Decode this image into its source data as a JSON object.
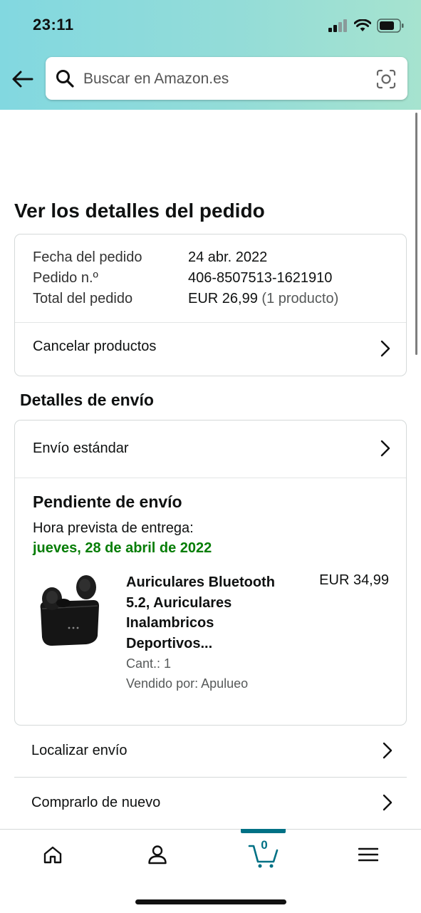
{
  "status_bar": {
    "time": "23:11"
  },
  "search": {
    "placeholder": "Buscar en Amazon.es"
  },
  "page": {
    "title": "Ver los detalles del pedido"
  },
  "order_summary": {
    "date_label": "Fecha del pedido",
    "date_value": "24 abr. 2022",
    "number_label": "Pedido n.º",
    "number_value": "406-8507513-1621910",
    "total_label": "Total del pedido",
    "total_value": "EUR 26,99",
    "total_items": "(1 producto)",
    "cancel_label": "Cancelar productos"
  },
  "shipping": {
    "section_title": "Detalles de envío",
    "method": "Envío estándar",
    "status": "Pendiente de envío",
    "eta_label": "Hora prevista de entrega:",
    "eta_date": "jueves, 28 de abril de 2022"
  },
  "product": {
    "title_line1": "Auriculares Bluetooth",
    "title_line2": "5.2, Auriculares",
    "title_line3": "Inalambricos",
    "title_line4": "Deportivos...",
    "price": "EUR 34,99",
    "quantity": "Cant.: 1",
    "seller": "Vendido por: Apulueo"
  },
  "actions": {
    "track": "Localizar envío",
    "buy_again": "Comprarlo de nuevo"
  },
  "tabbar": {
    "cart_count": "0",
    "active_tab": "cart"
  },
  "colors": {
    "accent": "#007185",
    "eta_green": "#067d06",
    "header_start": "#82d8e0",
    "header_end": "#a6e3cf"
  }
}
